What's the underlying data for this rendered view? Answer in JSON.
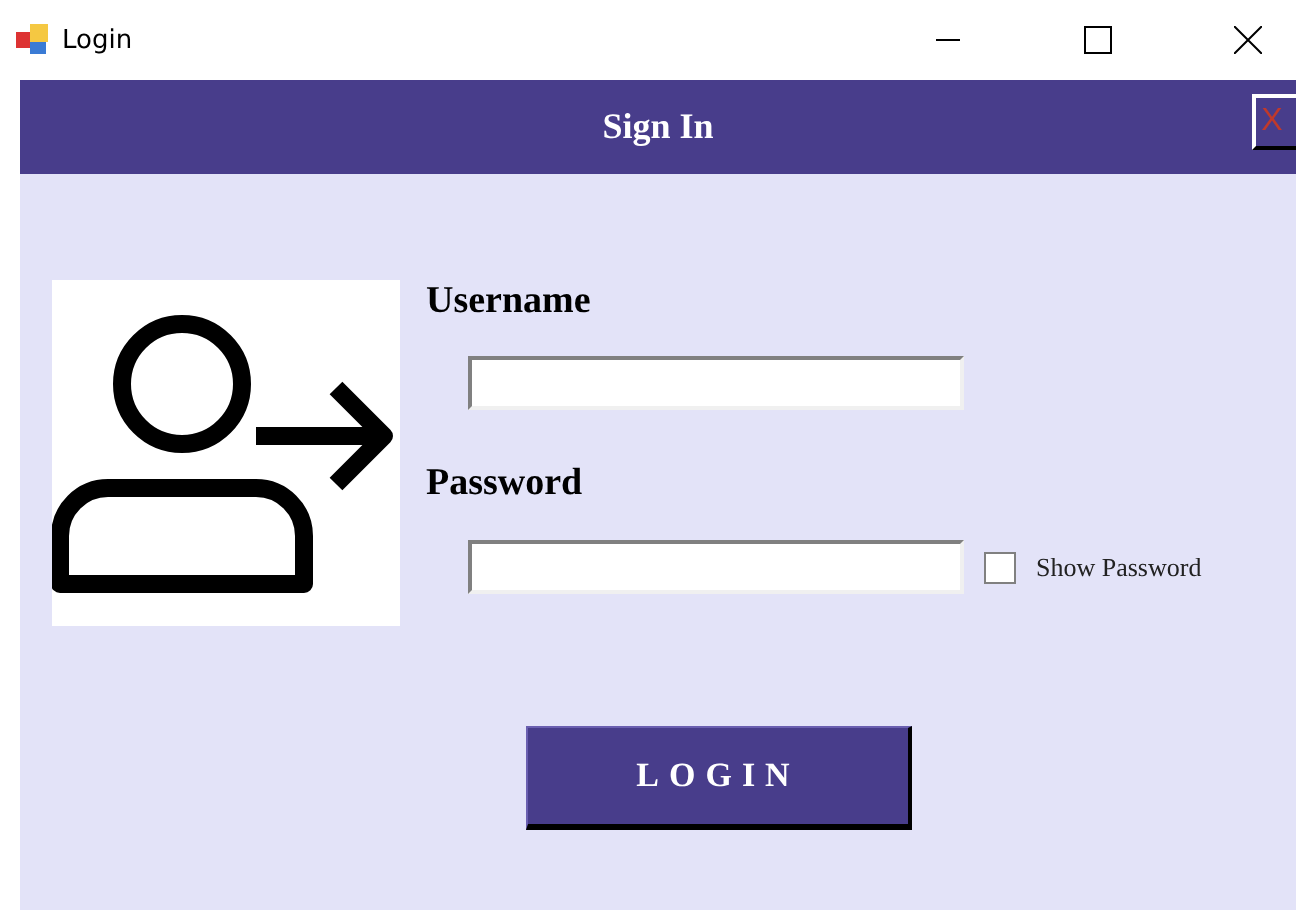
{
  "window": {
    "title": "Login"
  },
  "header": {
    "title": "Sign In",
    "close": "X"
  },
  "form": {
    "username": {
      "label": "Username"
    },
    "password": {
      "label": "Password"
    },
    "show_password": {
      "label": "Show Password",
      "checked": false
    },
    "login_button": "LOGIN"
  }
}
